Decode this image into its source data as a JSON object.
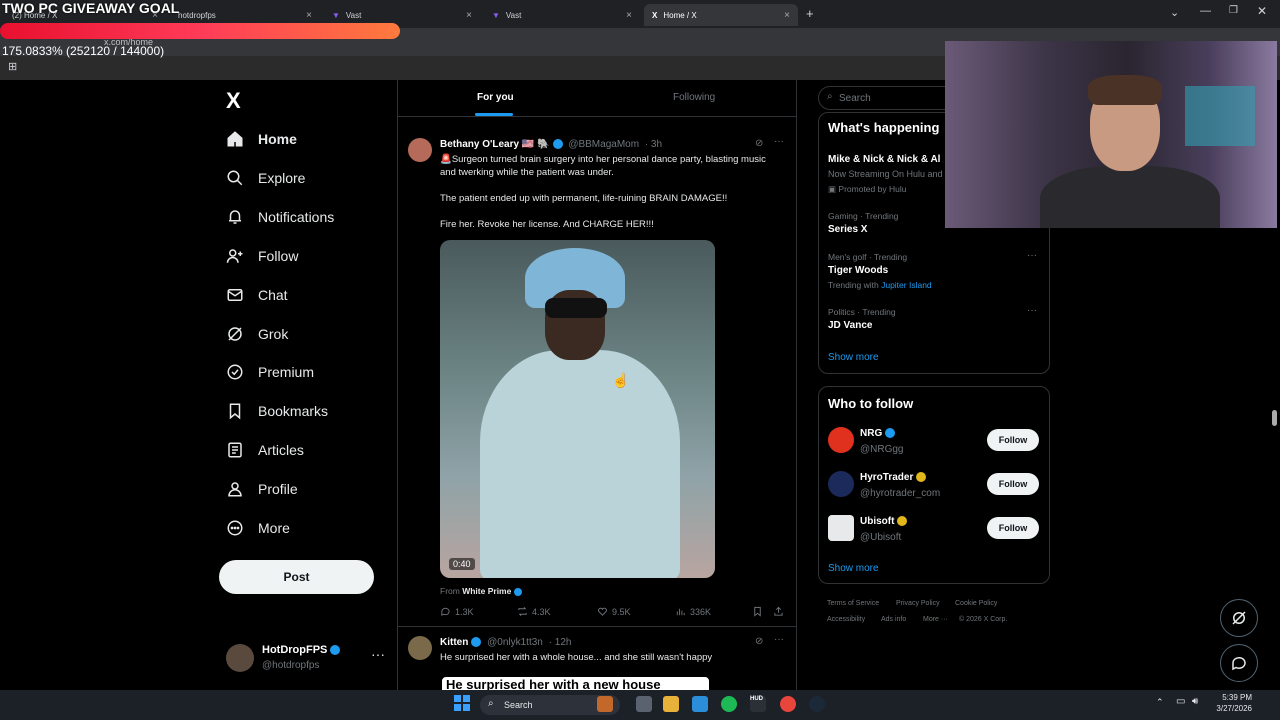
{
  "overlay": {
    "goal_title": "TWO PC GIVEAWAY GOAL",
    "goal_stats": "175.0833% (252120 / 144000)",
    "goal_percent": 175.0833
  },
  "browser": {
    "tabs": [
      {
        "label": "(2) Home / X"
      },
      {
        "label": "hotdropfps"
      },
      {
        "label": "Vast"
      },
      {
        "label": "Vast"
      },
      {
        "label": "Home / X"
      }
    ],
    "url": "x.com/home"
  },
  "sidebar": {
    "logo": "X",
    "items": [
      {
        "label": "Home",
        "icon": "home-icon"
      },
      {
        "label": "Explore",
        "icon": "search-icon"
      },
      {
        "label": "Notifications",
        "icon": "bell-icon"
      },
      {
        "label": "Follow",
        "icon": "person-add-icon"
      },
      {
        "label": "Chat",
        "icon": "mail-icon"
      },
      {
        "label": "Grok",
        "icon": "grok-icon"
      },
      {
        "label": "Premium",
        "icon": "premium-icon"
      },
      {
        "label": "Bookmarks",
        "icon": "bookmark-icon"
      },
      {
        "label": "Articles",
        "icon": "articles-icon"
      },
      {
        "label": "Profile",
        "icon": "person-icon"
      },
      {
        "label": "More",
        "icon": "more-icon"
      }
    ],
    "post_label": "Post",
    "account": {
      "name": "HotDropFPS",
      "handle": "@hotdropfps"
    }
  },
  "feed": {
    "tabs": {
      "for_you": "For you",
      "following": "Following"
    },
    "tweet1": {
      "name": "Bethany O'Leary 🇺🇸 🐘",
      "handle": "@BBMagaMom",
      "time": "· 3h",
      "line1": "🚨Surgeon turned brain surgery into her personal dance party, blasting music",
      "line2": "and twerking while the patient was under.",
      "line3": "The patient ended up with permanent, life-ruining BRAIN DAMAGE!!",
      "line4": "Fire her. Revoke her license. And CHARGE HER!!!",
      "video_time": "0:40",
      "from_prefix": "From",
      "from_name": "White Prime",
      "replies": "1.3K",
      "reposts": "4.3K",
      "likes": "9.5K",
      "views": "336K"
    },
    "tweet2": {
      "name": "Kitten",
      "handle": "@0nlyk1tt3n",
      "time": "· 12h",
      "text": "He surprised her with a whole house... and she still wasn't happy",
      "media_caption": "He surprised her with a new house"
    }
  },
  "right": {
    "search_placeholder": "Search",
    "happening_title": "What's happening",
    "trends": [
      {
        "meta": "",
        "title": "Mike & Nick & Nick & Al",
        "sub": "Now Streaming On Hulu and",
        "promo": "Promoted by Hulu"
      },
      {
        "meta": "Gaming · Trending",
        "title": "Series X"
      },
      {
        "meta": "Men's golf · Trending",
        "title": "Tiger Woods",
        "sub_prefix": "Trending with",
        "sub_link": "Jupiter Island"
      },
      {
        "meta": "Politics · Trending",
        "title": "JD Vance"
      }
    ],
    "show_more": "Show more",
    "wtf_title": "Who to follow",
    "follows": [
      {
        "name": "NRG",
        "handle": "@NRGgg",
        "button": "Follow"
      },
      {
        "name": "HyroTrader",
        "handle": "@hyrotrader_com",
        "button": "Follow"
      },
      {
        "name": "Ubisoft",
        "handle": "@Ubisoft",
        "button": "Follow"
      }
    ],
    "show_more_2": "Show more",
    "footer": {
      "terms": "Terms of Service",
      "privacy": "Privacy Policy",
      "cookie": "Cookie Policy",
      "accessibility": "Accessibility",
      "ads": "Ads info",
      "more": "More ···",
      "copyright": "© 2026 X Corp."
    }
  },
  "taskbar": {
    "search": "Search",
    "time": "5:39 PM",
    "date": "3/27/2026"
  }
}
